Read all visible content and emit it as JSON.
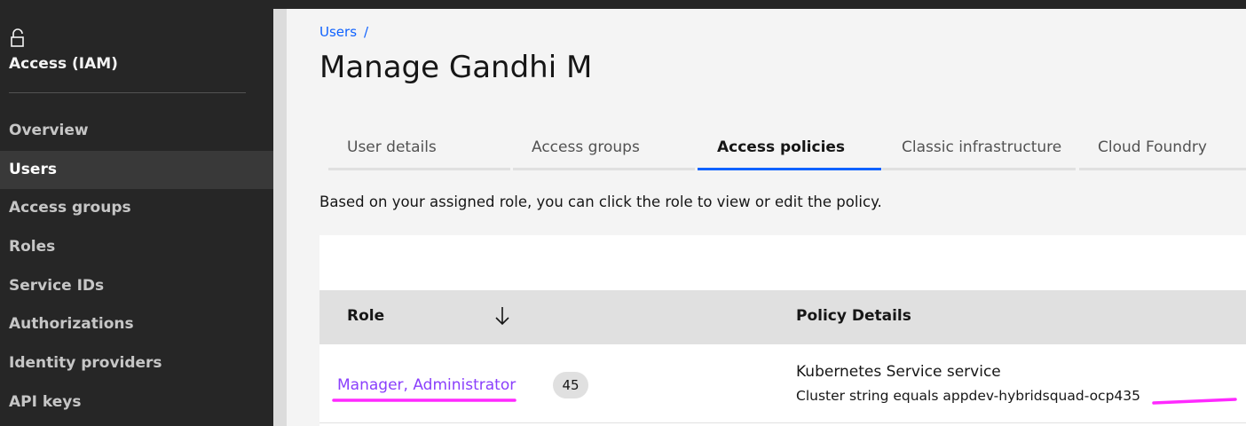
{
  "sidebar": {
    "heading": "Access (IAM)",
    "items": [
      {
        "label": "Overview"
      },
      {
        "label": "Users"
      },
      {
        "label": "Access groups"
      },
      {
        "label": "Roles"
      },
      {
        "label": "Service IDs"
      },
      {
        "label": "Authorizations"
      },
      {
        "label": "Identity providers"
      },
      {
        "label": "API keys"
      }
    ],
    "active_item": "Users"
  },
  "breadcrumb": {
    "item": "Users",
    "separator": "/"
  },
  "page": {
    "title": "Manage Gandhi M"
  },
  "tabs": [
    {
      "label": "User details"
    },
    {
      "label": "Access groups"
    },
    {
      "label": "Access policies"
    },
    {
      "label": "Classic infrastructure"
    },
    {
      "label": "Cloud Foundry"
    }
  ],
  "active_tab": "Access policies",
  "helper_text": "Based on your assigned role, you can click the role to view or edit the policy.",
  "table": {
    "headers": {
      "role": "Role",
      "policy_details": "Policy Details"
    },
    "rows": [
      {
        "role": "Manager, Administrator",
        "count": "45",
        "policy_service": "Kubernetes Service service",
        "policy_detail": "Cluster string equals appdev-hybridsquad-ocp435"
      }
    ]
  },
  "colors": {
    "sidebar_bg": "#262626",
    "accent_blue": "#0f62fe",
    "role_link": "#8a3ffc",
    "annotation_magenta": "#ff29ff"
  },
  "icons": {
    "sidebar_header": "lock-icon",
    "sort": "arrow-down-icon"
  }
}
